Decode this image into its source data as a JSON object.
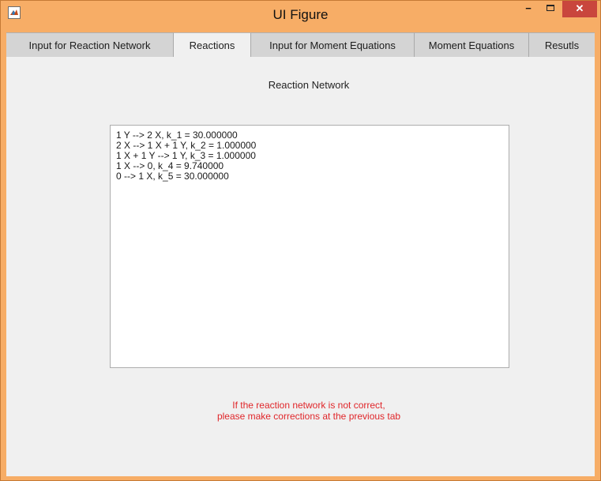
{
  "window": {
    "title": "UI Figure",
    "minimize_glyph": "−",
    "close_glyph": "✕",
    "icon": "matlab-icon"
  },
  "tabs": [
    {
      "label": "Input for Reaction Network",
      "active": false
    },
    {
      "label": "Reactions",
      "active": true
    },
    {
      "label": "Input for Moment Equations",
      "active": false
    },
    {
      "label": "Moment Equations",
      "active": false
    },
    {
      "label": "Resutls",
      "active": false
    }
  ],
  "main": {
    "section_title": "Reaction Network",
    "reactions": [
      "1 Y --> 2 X, k_1 = 30.000000",
      "2 X --> 1 X + 1 Y, k_2 = 1.000000",
      "1 X + 1 Y --> 1 Y, k_3 = 1.000000",
      "1 X --> 0, k_4 = 9.740000",
      "0 --> 1 X, k_5 = 30.000000"
    ],
    "warning_line1": "If the reaction network is not correct,",
    "warning_line2": "please make corrections at the previous tab"
  },
  "colors": {
    "title_bar": "#f7ad66",
    "close_button": "#c9463d",
    "warning_text": "#e0262a"
  }
}
